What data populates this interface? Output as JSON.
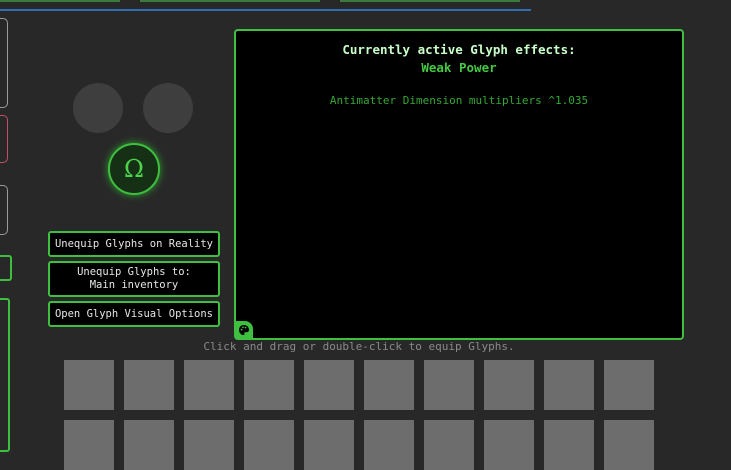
{
  "glyph_slots": {
    "center_symbol": "Ω",
    "empty_slots": [
      "empty-slot",
      "empty-slot"
    ]
  },
  "buttons": {
    "unequip_on_reality": "Unequip Glyphs on Reality",
    "unequip_to_line1": "Unequip Glyphs to:",
    "unequip_to_line2": "Main inventory",
    "visual_options": "Open Glyph Visual Options"
  },
  "effects_panel": {
    "title": "Currently active Glyph effects:",
    "glyph_name": "Weak Power",
    "effects": [
      "Antimatter Dimension multipliers ^1.035"
    ]
  },
  "inventory": {
    "hint": "Click and drag or double-click to equip Glyphs.",
    "rows": [
      [
        "",
        "",
        "",
        "",
        "",
        "",
        "",
        "",
        "",
        ""
      ],
      [
        "",
        "",
        "",
        "",
        "",
        "",
        "",
        "",
        "",
        ""
      ]
    ]
  },
  "colors": {
    "accent": "#3fbf3f",
    "background": "#282828",
    "panel_bg": "#000000",
    "empty_cell": "#6d6d6d"
  },
  "icons": {
    "customize": "palette-icon"
  }
}
